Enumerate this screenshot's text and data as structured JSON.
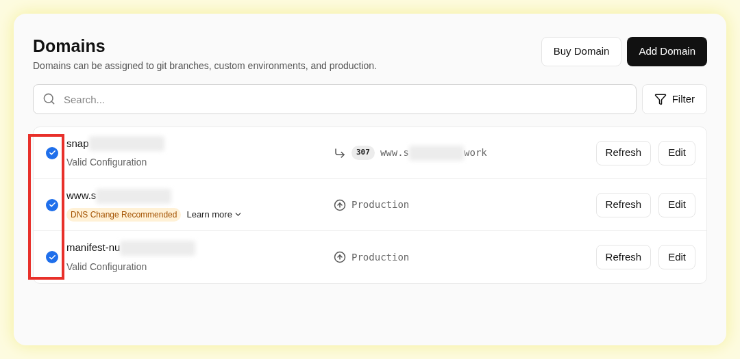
{
  "header": {
    "title": "Domains",
    "subtitle": "Domains can be assigned to git branches, custom environments, and production.",
    "buttons": [
      {
        "label": "Buy Domain",
        "kind": "secondary"
      },
      {
        "label": "Add Domain",
        "kind": "primary"
      }
    ]
  },
  "search": {
    "placeholder": "Search..."
  },
  "filter": {
    "label": "Filter"
  },
  "highlight_checkboxes": true,
  "domains": [
    {
      "name": "snap",
      "redacted": true,
      "checked": true,
      "status": {
        "kind": "text",
        "label": "Valid Configuration"
      },
      "target": {
        "kind": "redirect",
        "code": "307",
        "prefix": "www.s",
        "suffix": "work",
        "redacted": true
      },
      "actions": [
        "Refresh",
        "Edit"
      ]
    },
    {
      "name": "www.s",
      "redacted": true,
      "checked": true,
      "status": {
        "kind": "warning",
        "label": "DNS Change Recommended",
        "link": "Learn more"
      },
      "target": {
        "kind": "environment",
        "label": "Production"
      },
      "actions": [
        "Refresh",
        "Edit"
      ]
    },
    {
      "name": "manifest-nu",
      "redacted": true,
      "checked": true,
      "status": {
        "kind": "text",
        "label": "Valid Configuration"
      },
      "target": {
        "kind": "environment",
        "label": "Production"
      },
      "actions": [
        "Refresh",
        "Edit"
      ]
    }
  ]
}
